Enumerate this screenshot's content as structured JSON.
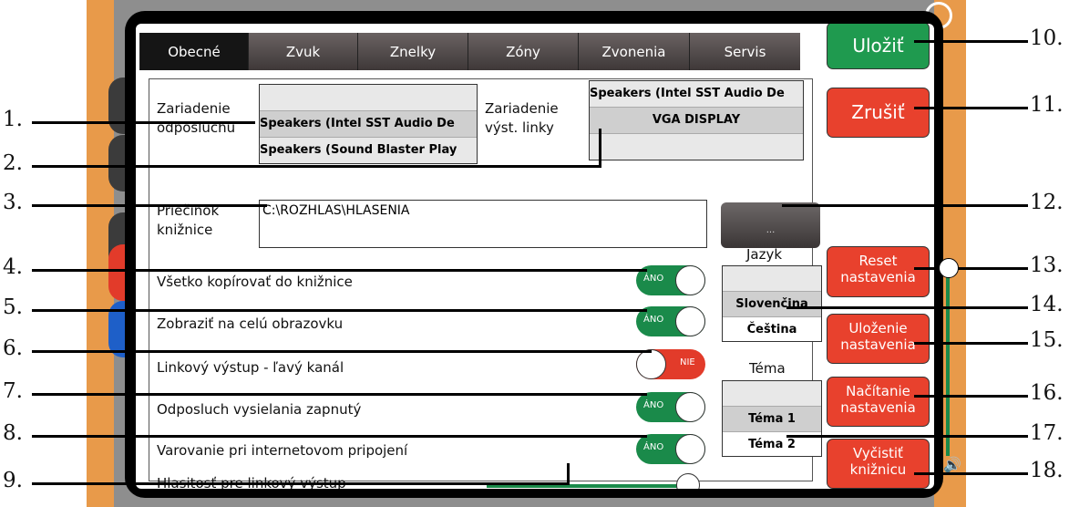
{
  "tabs": [
    {
      "label": "Obecné",
      "active": true
    },
    {
      "label": "Zvuk",
      "active": false
    },
    {
      "label": "Znelky",
      "active": false
    },
    {
      "label": "Zóny",
      "active": false
    },
    {
      "label": "Zvonenia",
      "active": false
    },
    {
      "label": "Servis",
      "active": false
    }
  ],
  "monitor_device": {
    "label_line1": "Zariadenie",
    "label_line2": "odposluchu",
    "options": [
      "",
      "Speakers (Intel SST Audio De",
      "Speakers (Sound Blaster Play"
    ],
    "selected": "Speakers (Intel SST Audio De"
  },
  "line_device": {
    "label_line1": "Zariadenie",
    "label_line2": "výst. linky",
    "options": [
      "Speakers (Intel SST Audio De",
      "VGA DISPLAY",
      ""
    ],
    "selected": "VGA DISPLAY"
  },
  "library": {
    "label_line1": "Priečinok",
    "label_line2": "knižnice",
    "path": "C:\\ROZHLAS\\HLASENIA",
    "browse_label": "..."
  },
  "toggles": [
    {
      "label": "Všetko kopírovať do knižnice",
      "state": "ÁNO",
      "on": true
    },
    {
      "label": "Zobraziť na celú obrazovku",
      "state": "ÁNO",
      "on": true
    },
    {
      "label": "Linkový výstup - ľavý kanál",
      "state": "NIE",
      "on": false
    },
    {
      "label": "Odposluch vysielania zapnutý",
      "state": "ÁNO",
      "on": true
    },
    {
      "label": "Varovanie pri internetovom pripojení",
      "state": "ÁNO",
      "on": true
    }
  ],
  "volume": {
    "label": "Hlasitosť pre linkový výstup",
    "level": 1.0
  },
  "language": {
    "title": "Jazyk",
    "options": [
      "",
      "Slovenčina",
      "Čeština"
    ],
    "selected": "Slovenčina"
  },
  "theme": {
    "title": "Téma",
    "options": [
      "",
      "Téma 1",
      "Téma 2"
    ],
    "selected": "Téma 2"
  },
  "buttons": {
    "save": "Uložiť",
    "cancel": "Zrušiť",
    "reset": [
      "Reset",
      "nastavenia"
    ],
    "save_settings": [
      "Uloženie",
      "nastavenia"
    ],
    "load_settings": [
      "Načítanie",
      "nastavenia"
    ],
    "clear_library": [
      "Vyčistiť",
      "knižnicu"
    ]
  },
  "callouts": [
    "1.",
    "2.",
    "3.",
    "4.",
    "5.",
    "6.",
    "7.",
    "8.",
    "9.",
    "10.",
    "11.",
    "12.",
    "13.",
    "14.",
    "15.",
    "16.",
    "17.",
    "18."
  ],
  "colors": {
    "on": "#1a8a4a",
    "off": "#e23b2a",
    "save": "#1f9a4f",
    "danger": "#e8412d"
  }
}
